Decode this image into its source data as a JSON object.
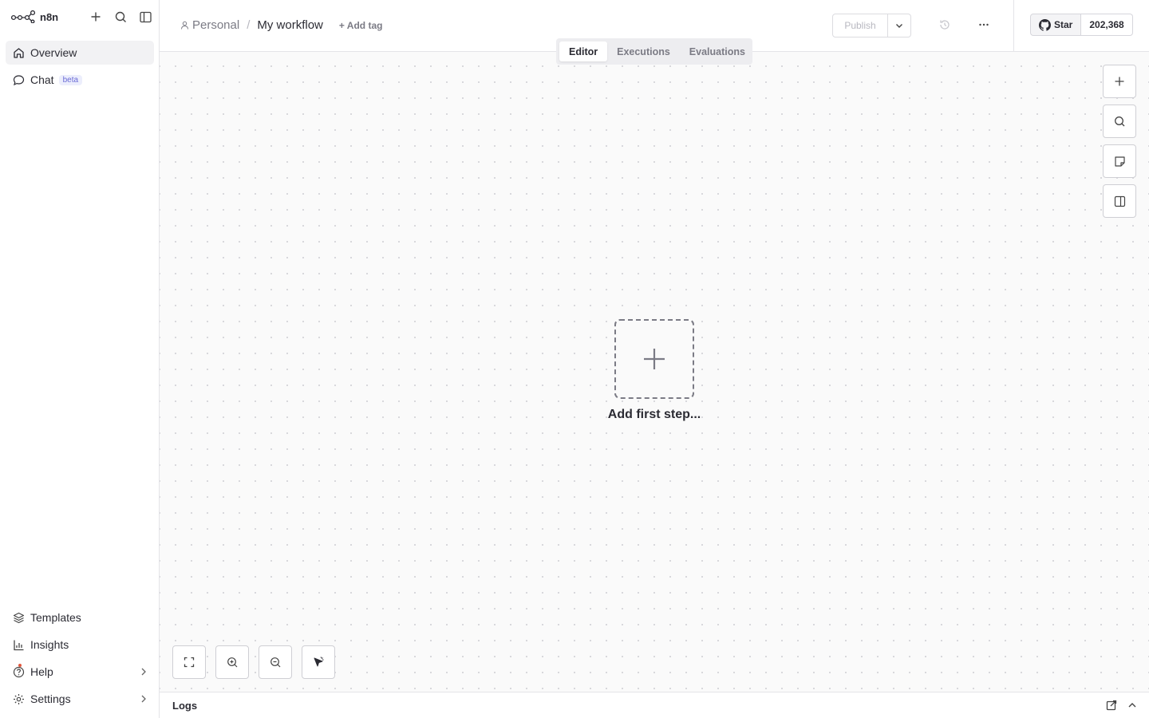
{
  "app": {
    "logo_text": "n8n"
  },
  "sidebar": {
    "top_icons": [
      "plus-icon",
      "search-icon",
      "sidebar-toggle-icon"
    ],
    "items": [
      {
        "label": "Overview",
        "icon": "home-icon",
        "active": true
      },
      {
        "label": "Chat",
        "icon": "chat-icon",
        "badge": "beta"
      }
    ],
    "bottom_items": [
      {
        "label": "Templates",
        "icon": "templates-icon"
      },
      {
        "label": "Insights",
        "icon": "chart-icon"
      },
      {
        "label": "Help",
        "icon": "help-icon",
        "has_chevron": true
      },
      {
        "label": "Settings",
        "icon": "gear-icon",
        "has_chevron": true
      }
    ]
  },
  "header": {
    "breadcrumb_project": "Personal",
    "breadcrumb_separator": "/",
    "workflow_name": "My workflow",
    "add_tag_label": "+ Add tag",
    "publish_label": "Publish",
    "github_star_label": "Star",
    "github_star_count": "202,368"
  },
  "tabs": [
    {
      "label": "Editor",
      "active": true
    },
    {
      "label": "Executions"
    },
    {
      "label": "Evaluations"
    }
  ],
  "canvas": {
    "add_first_step_label": "Add first step...",
    "side_buttons": [
      "plus-icon",
      "search-icon",
      "sticky-note-icon",
      "panel-icon"
    ],
    "bottom_controls": [
      "fit-view-icon",
      "zoom-in-icon",
      "zoom-out-icon",
      "tidy-up-icon"
    ]
  },
  "logs": {
    "label": "Logs"
  },
  "colors": {
    "accent_beta": "#6b6bd6",
    "help_dot": "#e2583e",
    "canvas_bg": "#fafafa"
  }
}
